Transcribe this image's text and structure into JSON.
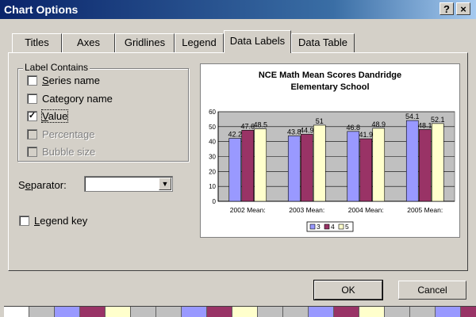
{
  "window": {
    "title": "Chart Options",
    "help_label": "?",
    "close_label": "×"
  },
  "tabs": [
    {
      "label": "Titles",
      "active": false
    },
    {
      "label": "Axes",
      "active": false
    },
    {
      "label": "Gridlines",
      "active": false
    },
    {
      "label": "Legend",
      "active": false
    },
    {
      "label": "Data Labels",
      "active": true
    },
    {
      "label": "Data Table",
      "active": false
    }
  ],
  "label_contains": {
    "title": "Label Contains",
    "options": [
      {
        "label": "Series name",
        "checked": false,
        "enabled": true
      },
      {
        "label": "Category name",
        "checked": false,
        "enabled": true
      },
      {
        "label": "Value",
        "checked": true,
        "enabled": true
      },
      {
        "label": "Percentage",
        "checked": false,
        "enabled": false
      },
      {
        "label": "Bubble size",
        "checked": false,
        "enabled": false
      }
    ]
  },
  "separator": {
    "label": "Separator:",
    "value": ""
  },
  "legend_key": {
    "label": "Legend key",
    "checked": false
  },
  "buttons": {
    "ok": "OK",
    "cancel": "Cancel"
  },
  "colors": {
    "series_3": "#9999ff",
    "series_4": "#993366",
    "series_5": "#ffffcc",
    "title_bar": "#0a246a",
    "dialog_bg": "#d4d0c8"
  },
  "chart_data": {
    "type": "bar",
    "title": "NCE Math Mean Scores Dandridge Elementary School",
    "title_lines": [
      "NCE Math Mean Scores Dandridge",
      "Elementary School"
    ],
    "categories": [
      "2002 Mean:",
      "2003 Mean:",
      "2004 Mean:",
      "2005 Mean:"
    ],
    "series": [
      {
        "name": "3",
        "color": "#9999ff",
        "values": [
          42.2,
          43.8,
          46.8,
          54.1
        ]
      },
      {
        "name": "4",
        "color": "#993366",
        "values": [
          47.6,
          44.9,
          41.9,
          48.1
        ]
      },
      {
        "name": "5",
        "color": "#ffffcc",
        "values": [
          48.5,
          51,
          48.9,
          52.1
        ]
      }
    ],
    "ylim": [
      0,
      60
    ],
    "yticks": [
      0,
      10,
      20,
      30,
      40,
      50,
      60
    ],
    "grid": true,
    "legend": "bottom",
    "data_labels": true
  },
  "color_strip": [
    "#ffffff",
    "#c0c0c0",
    "#9999ff",
    "#993366",
    "#ffffcc",
    "#c0c0c0",
    "#c0c0c0",
    "#9999ff",
    "#993366",
    "#ffffcc",
    "#c0c0c0",
    "#c0c0c0",
    "#9999ff",
    "#993366",
    "#ffffcc",
    "#c0c0c0",
    "#c0c0c0",
    "#9999ff",
    "#993366"
  ]
}
